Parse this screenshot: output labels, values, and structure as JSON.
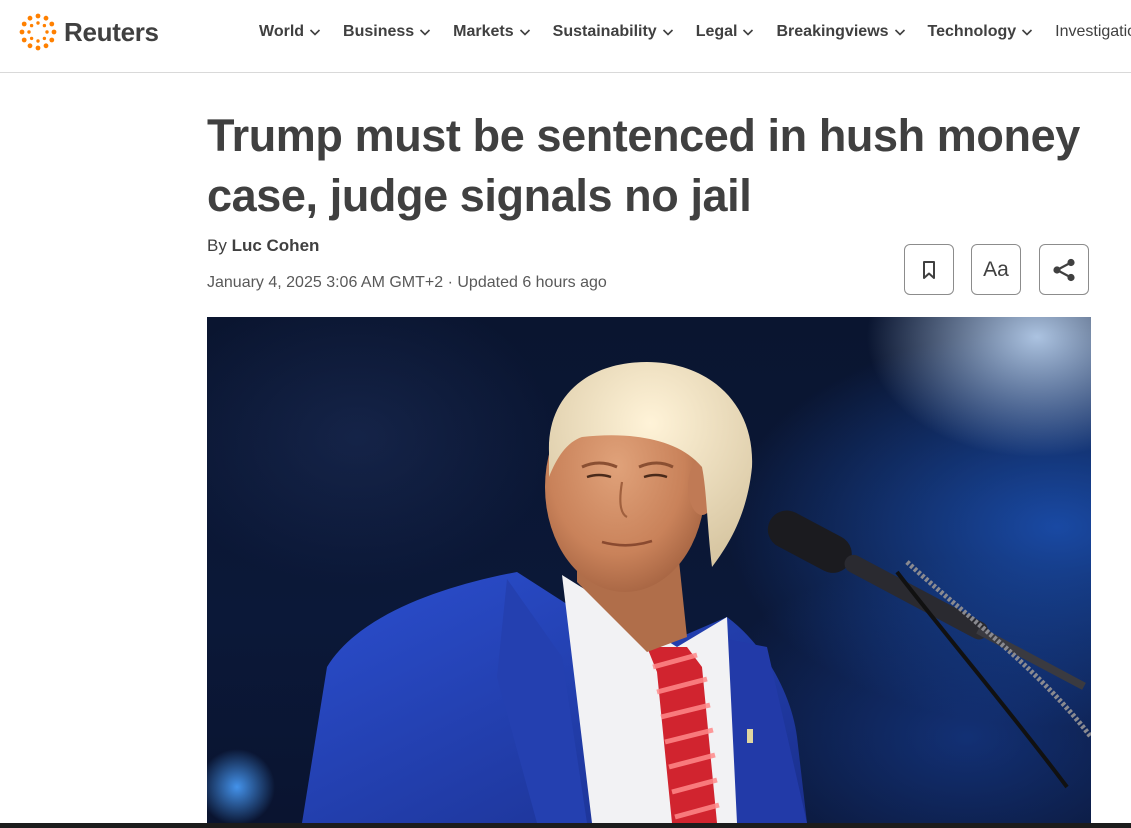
{
  "site": {
    "logo_text": "Reuters",
    "brand_color": "#ff8000"
  },
  "nav": {
    "items": [
      {
        "label": "World"
      },
      {
        "label": "Business"
      },
      {
        "label": "Markets"
      },
      {
        "label": "Sustainability"
      },
      {
        "label": "Legal"
      },
      {
        "label": "Breakingviews"
      },
      {
        "label": "Technology"
      },
      {
        "label": "Investigations"
      }
    ]
  },
  "article": {
    "headline": "Trump must be sentenced in hush money case, judge signals no jail",
    "byline_prefix": "By",
    "author": "Luc Cohen",
    "published": "January 4, 2025 3:06 AM GMT+2",
    "separator": "·",
    "updated": "Updated 6 hours ago"
  },
  "tools": {
    "text_size_label": "Aa",
    "icons": [
      "bookmark-icon",
      "text-size-icon",
      "share-icon"
    ]
  },
  "hero_image": {
    "subject": "photo of a man in a blue suit with red striped tie at a microphone"
  }
}
